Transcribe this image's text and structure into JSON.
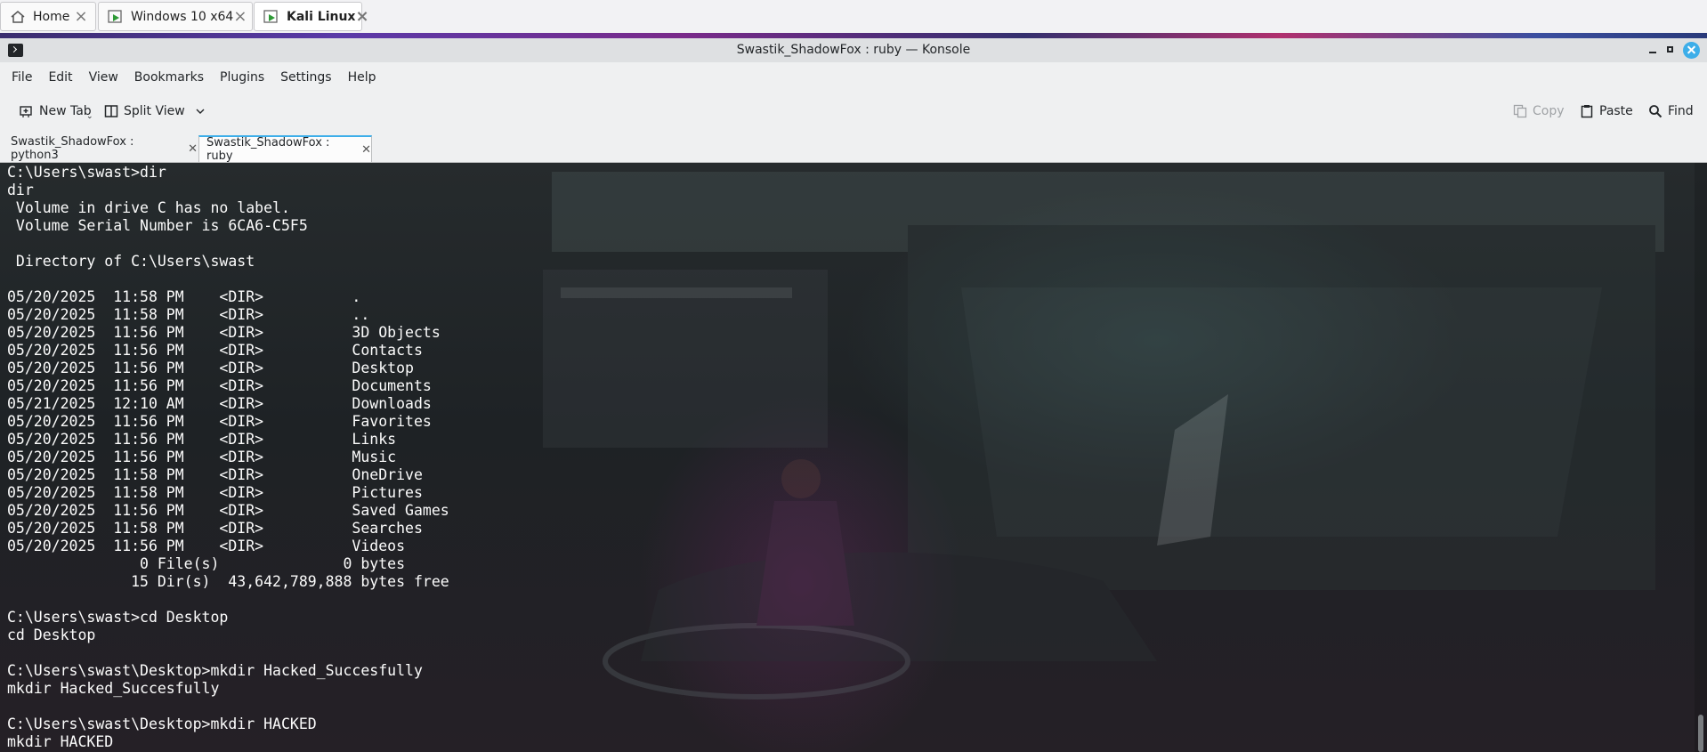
{
  "vm_tabs": [
    {
      "label": "Home",
      "icon": "home-icon",
      "active": false
    },
    {
      "label": "Windows 10 x64",
      "icon": "vm-play-icon",
      "active": false
    },
    {
      "label": "Kali Linux",
      "icon": "vm-play-icon",
      "active": true
    }
  ],
  "window": {
    "title": "Swastik_ShadowFox : ruby — Konsole"
  },
  "menu": [
    "File",
    "Edit",
    "View",
    "Bookmarks",
    "Plugins",
    "Settings",
    "Help"
  ],
  "toolbar": {
    "new_tab": "New Tab",
    "split_view": "Split View",
    "copy": "Copy",
    "paste": "Paste",
    "find": "Find"
  },
  "terminal_tabs": [
    {
      "label": "Swastik_ShadowFox : python3",
      "active": false
    },
    {
      "label": "Swastik_ShadowFox : ruby",
      "active": true
    }
  ],
  "terminal": {
    "lines": [
      "C:\\Users\\swast>dir",
      "dir",
      " Volume in drive C has no label.",
      " Volume Serial Number is 6CA6-C5F5",
      "",
      " Directory of C:\\Users\\swast",
      "",
      "05/20/2025  11:58 PM    <DIR>          .",
      "05/20/2025  11:58 PM    <DIR>          ..",
      "05/20/2025  11:56 PM    <DIR>          3D Objects",
      "05/20/2025  11:56 PM    <DIR>          Contacts",
      "05/20/2025  11:56 PM    <DIR>          Desktop",
      "05/20/2025  11:56 PM    <DIR>          Documents",
      "05/21/2025  12:10 AM    <DIR>          Downloads",
      "05/20/2025  11:56 PM    <DIR>          Favorites",
      "05/20/2025  11:56 PM    <DIR>          Links",
      "05/20/2025  11:56 PM    <DIR>          Music",
      "05/20/2025  11:58 PM    <DIR>          OneDrive",
      "05/20/2025  11:58 PM    <DIR>          Pictures",
      "05/20/2025  11:56 PM    <DIR>          Saved Games",
      "05/20/2025  11:58 PM    <DIR>          Searches",
      "05/20/2025  11:56 PM    <DIR>          Videos",
      "               0 File(s)              0 bytes",
      "              15 Dir(s)  43,642,789,888 bytes free",
      "",
      "C:\\Users\\swast>cd Desktop",
      "cd Desktop",
      "",
      "C:\\Users\\swast\\Desktop>mkdir Hacked_Succesfully",
      "mkdir Hacked_Succesfully",
      "",
      "C:\\Users\\swast\\Desktop>mkdir HACKED",
      "mkdir HACKED"
    ]
  },
  "colors": {
    "accent": "#3daee9",
    "terminal_text": "#fcfcfc"
  }
}
